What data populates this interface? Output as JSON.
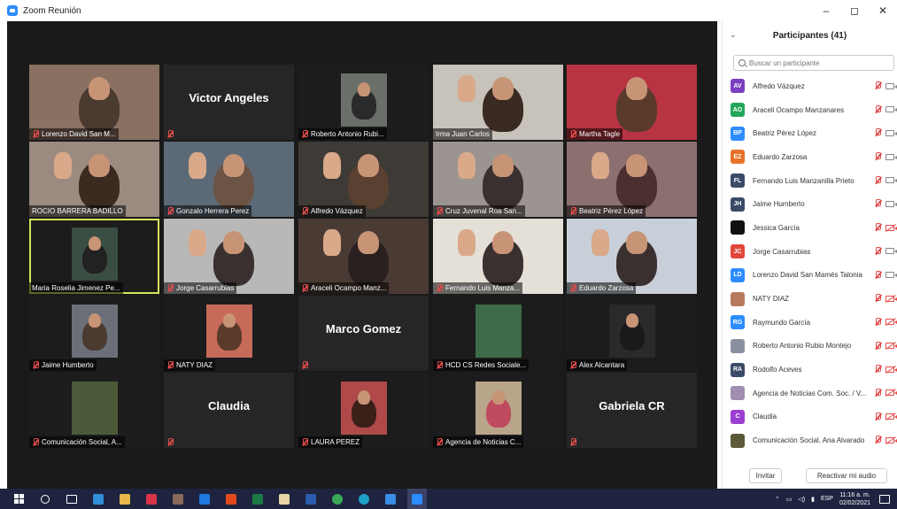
{
  "window": {
    "title": "Zoom Reunión",
    "minimize": "–",
    "maximize": "◻",
    "close": "✕"
  },
  "tiles": [
    {
      "label": "Lorenzo David San M...",
      "bigname": "",
      "mic_muted": true
    },
    {
      "label": "",
      "bigname": "Victor Angeles",
      "mic_muted": true
    },
    {
      "label": "Roberto Antonio Rubi...",
      "bigname": "",
      "mic_muted": true
    },
    {
      "label": "Irma Juan Carlos",
      "bigname": "",
      "mic_muted": false
    },
    {
      "label": "Martha Tagle",
      "bigname": "",
      "mic_muted": true
    },
    {
      "label": "ROCIO BARRERA BADILLO",
      "bigname": "",
      "mic_muted": false
    },
    {
      "label": "Gonzalo Herrera Perez",
      "bigname": "",
      "mic_muted": true
    },
    {
      "label": "Alfredo Vázquez",
      "bigname": "",
      "mic_muted": true
    },
    {
      "label": "Cruz Juvenal Roa San...",
      "bigname": "",
      "mic_muted": true
    },
    {
      "label": "Beatriz Pérez López",
      "bigname": "",
      "mic_muted": true
    },
    {
      "label": "Maria Roselia Jimenez Pe...",
      "bigname": "",
      "mic_muted": false
    },
    {
      "label": "Jorge Casarrubias",
      "bigname": "",
      "mic_muted": true
    },
    {
      "label": "Araceli Ocampo Manz...",
      "bigname": "",
      "mic_muted": true
    },
    {
      "label": "Fernando Luis Manza...",
      "bigname": "",
      "mic_muted": true
    },
    {
      "label": "Eduardo Zarzosa",
      "bigname": "",
      "mic_muted": true
    },
    {
      "label": "Jaime Humberto",
      "bigname": "",
      "mic_muted": true
    },
    {
      "label": "NATY DIAZ",
      "bigname": "",
      "mic_muted": true
    },
    {
      "label": "",
      "bigname": "Marco Gomez",
      "mic_muted": true
    },
    {
      "label": "HCD CS Redes Sociale...",
      "bigname": "",
      "mic_muted": true
    },
    {
      "label": "Alex Alcantara",
      "bigname": "",
      "mic_muted": true
    },
    {
      "label": "Comunicación Social, A...",
      "bigname": "",
      "mic_muted": true
    },
    {
      "label": "",
      "bigname": "Claudia",
      "mic_muted": true
    },
    {
      "label": "LAURA PEREZ",
      "bigname": "",
      "mic_muted": true
    },
    {
      "label": "Agencia de Noticias C...",
      "bigname": "",
      "mic_muted": true
    },
    {
      "label": "",
      "bigname": "Gabriela CR",
      "mic_muted": true
    }
  ],
  "panel": {
    "title": "Participantes (41)",
    "collapse_icon": "⌄",
    "search_placeholder": "Buscar un participante",
    "participants": [
      {
        "initials": "AV",
        "name": "Alfredo Vázquez",
        "color": "#7b3fbf",
        "camera_off": false
      },
      {
        "initials": "AO",
        "name": "Araceli Ocampo Manzanares",
        "color": "#22a65a",
        "camera_off": false
      },
      {
        "initials": "BP",
        "name": "Beatriz Pérez López",
        "color": "#2d8cff",
        "camera_off": false
      },
      {
        "initials": "EZ",
        "name": "Eduardo Zarzosa",
        "color": "#e8722a",
        "camera_off": false
      },
      {
        "initials": "FL",
        "name": "Fernando Luis Manzanilla Prieto",
        "color": "#3b4a66",
        "camera_off": false
      },
      {
        "initials": "JH",
        "name": "Jaime Humberto",
        "color": "#3b4a66",
        "camera_off": false
      },
      {
        "initials": "",
        "name": "Jessica García",
        "color": "#111111",
        "camera_off": true
      },
      {
        "initials": "JC",
        "name": "Jorge Casarrubias",
        "color": "#e0463a",
        "camera_off": false
      },
      {
        "initials": "LD",
        "name": "Lorenzo David San Mamés Talonia",
        "color": "#2d8cff",
        "camera_off": false
      },
      {
        "initials": "",
        "name": "NATY DIAZ",
        "color": "#b77a5e",
        "camera_off": true
      },
      {
        "initials": "RG",
        "name": "Raymundo García",
        "color": "#2d8cff",
        "camera_off": true
      },
      {
        "initials": "",
        "name": "Roberto Antonio Rubio Montejo",
        "color": "#8a8fa0",
        "camera_off": true
      },
      {
        "initials": "RA",
        "name": "Rodolfo Aceves",
        "color": "#3b4a66",
        "camera_off": true
      },
      {
        "initials": "",
        "name": "Agencia de Noticias Com. Soc. / V...",
        "color": "#a08fb0",
        "camera_off": true
      },
      {
        "initials": "C",
        "name": "Claudia",
        "color": "#9b3fd1",
        "camera_off": true
      },
      {
        "initials": "",
        "name": "Comunicación Social, Ana Alvarado",
        "color": "#5d5a3a",
        "camera_off": true
      }
    ],
    "invite_label": "Invitar",
    "unmute_label": "Reactivar mi audio"
  },
  "taskbar": {
    "language": "ESP",
    "time": "11:16 a. m.",
    "date": "02/02/2021"
  }
}
